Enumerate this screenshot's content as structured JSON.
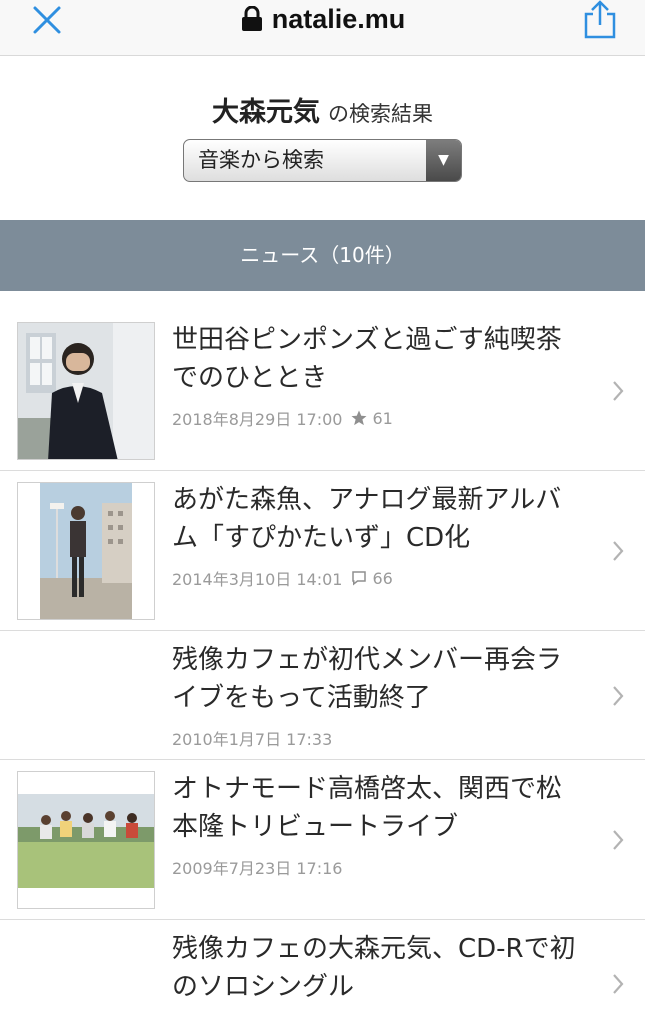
{
  "browser": {
    "url": "natalie.mu",
    "icons": [
      "close-icon",
      "lock-icon",
      "share-icon"
    ]
  },
  "search": {
    "term": "大森元気",
    "suffix": "の検索結果",
    "select_value": "音楽から検索"
  },
  "section": {
    "label": "ニュース（10件）"
  },
  "news": [
    {
      "title_line1": "世田谷ピンポンズと過ごす純喫茶",
      "title_line2": "でのひととき",
      "date": "2018年8月29日 17:00",
      "stat_icon": "star-icon",
      "stat": "61"
    },
    {
      "title_line1": "あがた森魚、アナログ最新アルバ",
      "title_line2": "ム「すぴかたいず」CD化",
      "date": "2014年3月10日 14:01",
      "stat_icon": "comment-icon",
      "stat": "66"
    },
    {
      "title_line1": "残像カフェが初代メンバー再会ラ",
      "title_line2": "イブをもって活動終了",
      "date": "2010年1月7日 17:33"
    },
    {
      "title_line1": "オトナモード高橋啓太、関西で松",
      "title_line2": "本隆トリビュートライブ",
      "date": "2009年7月23日 17:16"
    },
    {
      "title_line1": "残像カフェの大森元気、CD-Rで初",
      "title_line2": "のソロシングル"
    }
  ],
  "colors": {
    "accent": "#2f8fe0",
    "section_bar": "#7d8c99",
    "meta_text": "#9a9a9a"
  }
}
